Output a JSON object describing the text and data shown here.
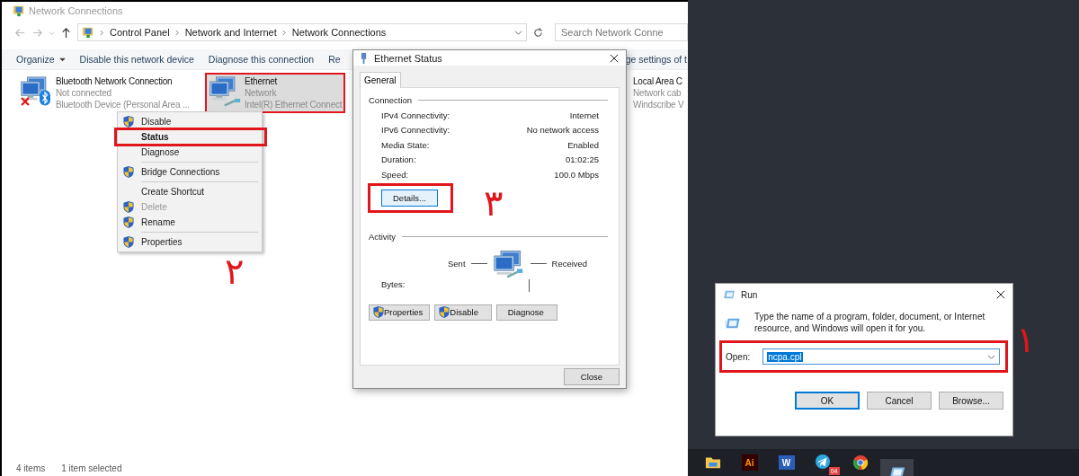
{
  "explorer": {
    "title": "Network Connections",
    "breadcrumb": [
      "Control Panel",
      "Network and Internet",
      "Network Connections"
    ],
    "search": {
      "placeholder": "Search Network Conne"
    },
    "toolbar": [
      {
        "label": "Organize",
        "kind": "menu"
      },
      {
        "label": "Disable this network device",
        "kind": "plain"
      },
      {
        "label": "Diagnose this connection",
        "kind": "plain"
      },
      {
        "label": "Re",
        "kind": "plain"
      },
      {
        "label": "ge settings of t",
        "kind": "end"
      }
    ],
    "connections": [
      {
        "name": "Bluetooth Network Connection",
        "status": "Not connected",
        "device": "Bluetooth Device (Personal Area ...",
        "kind": "bluetooth",
        "connected": false,
        "selected": false,
        "highlighted": false
      },
      {
        "name": "Ethernet",
        "status": "Network",
        "device": "Intel(R) Ethernet Connect",
        "kind": "ethernet",
        "connected": true,
        "selected": true,
        "highlighted": true
      },
      {
        "name": "Local Area C",
        "status": "Network cab",
        "device": "Windscribe V",
        "kind": "lan",
        "selected": false,
        "highlighted": false
      }
    ],
    "status_bar": [
      "4 items",
      "1 item selected"
    ]
  },
  "context_menu": {
    "groups": [
      [
        {
          "label": "Disable",
          "shield": true,
          "default": false,
          "disabled": false,
          "highlighted": false
        },
        {
          "label": "Status",
          "shield": false,
          "default": true,
          "disabled": false,
          "highlighted": true
        },
        {
          "label": "Diagnose",
          "shield": false,
          "default": false,
          "disabled": false,
          "highlighted": false
        }
      ],
      [
        {
          "label": "Bridge Connections",
          "shield": true,
          "default": false,
          "disabled": false,
          "highlighted": false
        }
      ],
      [
        {
          "label": "Create Shortcut",
          "shield": false,
          "default": false,
          "disabled": false,
          "highlighted": false
        },
        {
          "label": "Delete",
          "shield": true,
          "default": false,
          "disabled": true,
          "highlighted": false
        },
        {
          "label": "Rename",
          "shield": true,
          "default": false,
          "disabled": false,
          "highlighted": false
        }
      ],
      [
        {
          "label": "Properties",
          "shield": true,
          "default": false,
          "disabled": false,
          "highlighted": false
        }
      ]
    ]
  },
  "status_dialog": {
    "title": "Ethernet Status",
    "tabs": [
      {
        "label": "General",
        "selected": true
      }
    ],
    "connection": {
      "heading": "Connection",
      "rows": [
        {
          "label": "IPv4 Connectivity:",
          "value": "Internet"
        },
        {
          "label": "IPv6 Connectivity:",
          "value": "No network access"
        },
        {
          "label": "Media State:",
          "value": "Enabled"
        },
        {
          "label": "Duration:",
          "value": "01:02:25"
        },
        {
          "label": "Speed:",
          "value": "100.0 Mbps"
        }
      ],
      "details_button": {
        "label": "Details...",
        "highlighted": true
      }
    },
    "activity": {
      "heading": "Activity",
      "sent": "Sent",
      "received": "Received",
      "bytes": "Bytes:"
    },
    "buttons": [
      {
        "label": "Properties",
        "shield": true
      },
      {
        "label": "Disable",
        "shield": true
      },
      {
        "label": "Diagnose",
        "shield": false
      }
    ],
    "close": "Close"
  },
  "run_dialog": {
    "title": "Run",
    "description": "Type the name of a program, folder, document, or Internet resource, and Windows will open it for you.",
    "open_label": "Open:",
    "value": "ncpa.cpl",
    "highlighted": true,
    "buttons": [
      {
        "label": "OK",
        "default": true
      },
      {
        "label": "Cancel",
        "default": false
      },
      {
        "label": "Browse...",
        "default": false
      }
    ]
  },
  "taskbar": [
    {
      "kind": "folder",
      "active": false
    },
    {
      "kind": "illustrator",
      "label": "Ai",
      "active": false
    },
    {
      "kind": "word",
      "label": "W",
      "active": false
    },
    {
      "kind": "telegram",
      "badge": "04",
      "active": false
    },
    {
      "kind": "chrome",
      "active": false
    },
    {
      "kind": "run",
      "active": true
    }
  ],
  "step_markers": [
    {
      "label": "۱"
    },
    {
      "label": "۲"
    },
    {
      "label": "۳"
    }
  ]
}
